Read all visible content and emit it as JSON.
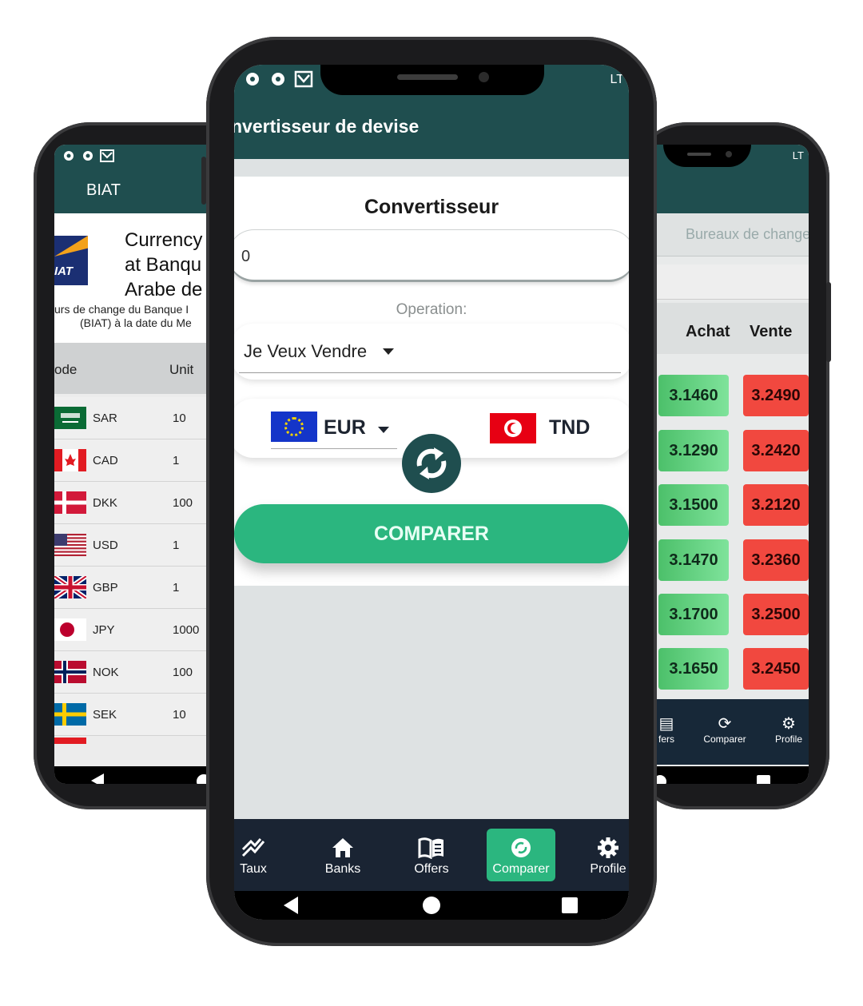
{
  "left_screen": {
    "app_title": "BIAT",
    "logo_text": "IAT",
    "heading_lines": [
      "Currency",
      "at Banqu",
      "Arabe de"
    ],
    "subtitle_lines": [
      "urs de change du Banque I",
      "(BIAT) à la date du Me"
    ],
    "table_headers": {
      "code": "ode",
      "unit": "Unit"
    },
    "rows": [
      {
        "code": "SAR",
        "unit": "10"
      },
      {
        "code": "CAD",
        "unit": "1"
      },
      {
        "code": "DKK",
        "unit": "100"
      },
      {
        "code": "USD",
        "unit": "1"
      },
      {
        "code": "GBP",
        "unit": "1"
      },
      {
        "code": "JPY",
        "unit": "1000"
      },
      {
        "code": "NOK",
        "unit": "100"
      },
      {
        "code": "SEK",
        "unit": "10"
      }
    ]
  },
  "center_screen": {
    "status_right": "LT",
    "app_title": "nvertisseur de devise",
    "card_title": "Convertisseur",
    "amount_value": "0",
    "operation_label": "Operation:",
    "operation_value": "Je Veux Vendre",
    "from_currency": "EUR",
    "to_currency": "TND",
    "compare_label": "COMPARER",
    "bottom_nav": [
      {
        "label": "Taux",
        "icon": "trend-icon"
      },
      {
        "label": "Banks",
        "icon": "home-icon"
      },
      {
        "label": "Offers",
        "icon": "book-icon"
      },
      {
        "label": "Comparer",
        "icon": "sync-icon",
        "active": true
      },
      {
        "label": "Profile",
        "icon": "gear-icon"
      }
    ],
    "accent_color": "#2bb67f",
    "header_color": "#1f4e4f"
  },
  "right_screen": {
    "status_right": "LT",
    "search_placeholder": "Bureaux de change",
    "headers": {
      "buy": "Achat",
      "sell": "Vente"
    },
    "rows": [
      {
        "buy": "3.1460",
        "sell": "3.2490"
      },
      {
        "buy": "3.1290",
        "sell": "3.2420"
      },
      {
        "buy": "3.1500",
        "sell": "3.2120"
      },
      {
        "buy": "3.1470",
        "sell": "3.2360"
      },
      {
        "buy": "3.1700",
        "sell": "3.2500"
      },
      {
        "buy": "3.1650",
        "sell": "3.2450"
      }
    ],
    "bottom_nav": [
      {
        "label": "fers",
        "icon": "book-icon"
      },
      {
        "label": "Comparer",
        "icon": "sync-icon"
      },
      {
        "label": "Profile",
        "icon": "gear-icon"
      }
    ]
  }
}
